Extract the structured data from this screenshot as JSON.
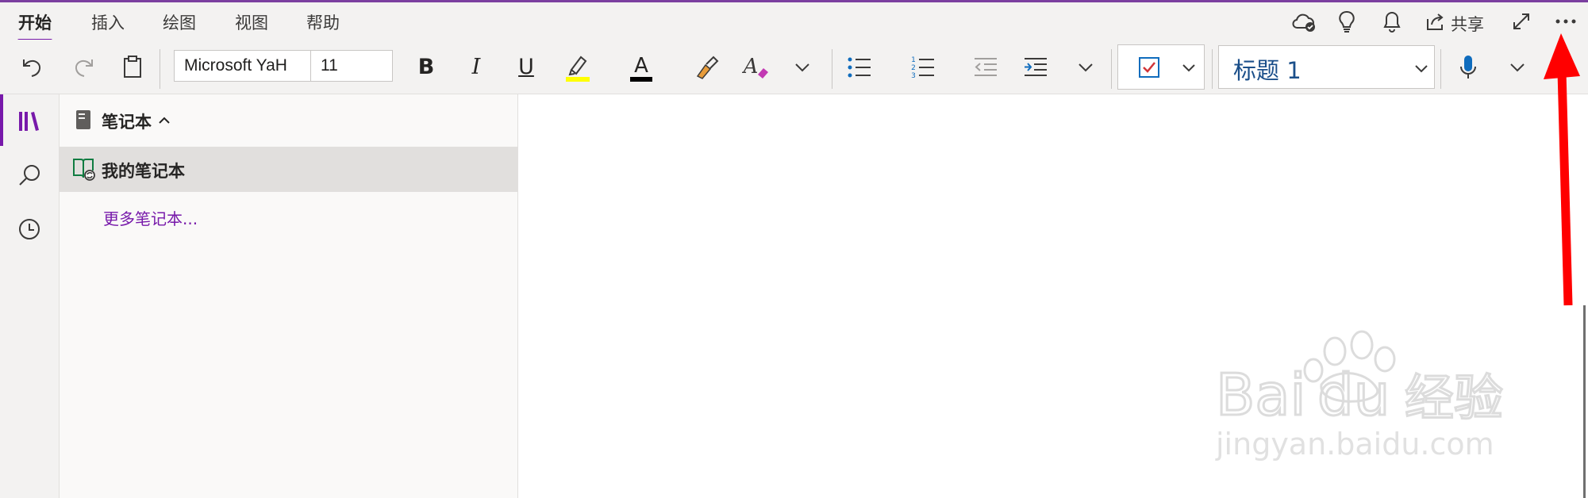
{
  "tabs": [
    {
      "label": "开始",
      "active": true
    },
    {
      "label": "插入"
    },
    {
      "label": "绘图"
    },
    {
      "label": "视图"
    },
    {
      "label": "帮助"
    }
  ],
  "header_actions": {
    "share_label": "共享",
    "icons": [
      "cloud-sync-icon",
      "lightbulb-icon",
      "bell-icon",
      "share-icon",
      "expand-icon",
      "more-options-icon"
    ]
  },
  "ribbon": {
    "font_name": "Microsoft YaH",
    "font_size": "11",
    "bold_glyph": "B",
    "italic_glyph": "I",
    "underline_glyph": "U",
    "font_color_glyph": "A",
    "style_value": "标题 1",
    "highlight_color": "#ffff00",
    "font_color": "#000000"
  },
  "navigation": {
    "notebooks_header": "笔记本",
    "notebooks": [
      {
        "label": "我的笔记本",
        "selected": true
      }
    ],
    "more_notebooks_link": "更多笔记本..."
  },
  "colors": {
    "accent": "#7719aa",
    "ribbon_bg": "#f3f2f1",
    "pane_bg": "#faf9f8",
    "selected_bg": "#e1dfdd",
    "annotation_arrow": "#ff0000"
  },
  "watermark": {
    "brand": "Bai du 经验",
    "url": "jingyan.baidu.com"
  }
}
